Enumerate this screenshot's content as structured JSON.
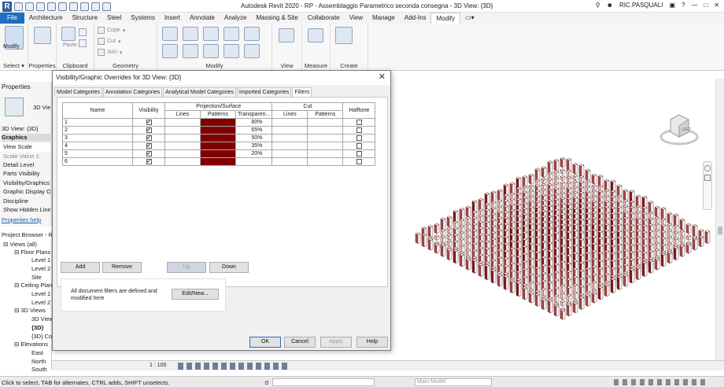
{
  "app": {
    "title": "Autodesk Revit 2020 - RP - Assemblaggio Parametrico seconda consegna - 3D View: {3D}",
    "user": "RIC.PASQUALI"
  },
  "ribbon": {
    "tabs": [
      "File",
      "Architecture",
      "Structure",
      "Steel",
      "Systems",
      "Insert",
      "Annotate",
      "Analyze",
      "Massing & Site",
      "Collaborate",
      "View",
      "Manage",
      "Add-Ins",
      "Modify"
    ],
    "active_tab": "Modify",
    "groups": {
      "select": "Select",
      "properties": "Properties",
      "clipboard": "Clipboard",
      "geometry": "Geometry",
      "modify": "Modify",
      "view": "View",
      "measure": "Measure",
      "create": "Create"
    },
    "modify_label": "Modify",
    "properties_label": "Properties",
    "paste_label": "Paste",
    "cope": "Cope",
    "cut": "Cut",
    "join": "Join"
  },
  "properties_panel": {
    "header": "Properties",
    "type": "3D Vie",
    "instance": "3D View: {3D}",
    "graphics": "Graphics",
    "rows": [
      "View Scale",
      "Scale Value   1:",
      "Detail Level",
      "Parts Visibility",
      "Visibility/Graphics",
      "Graphic Display Op",
      "Discipline",
      "Show Hidden Lines"
    ],
    "help": "Properties help"
  },
  "project_browser": {
    "header": "Project Browser - RP",
    "items": [
      "Views (all)",
      "Floor Plans",
      "Level 1",
      "Level 2",
      "Site",
      "Ceiling Plans",
      "Level 1",
      "Level 2",
      "3D Views",
      "3D View",
      "{3D}",
      "{3D} Co",
      "Elevations",
      "East",
      "North",
      "South"
    ]
  },
  "dialog": {
    "title": "Visibility/Graphic Overrides for 3D View: {3D}",
    "close": "✕",
    "tabs": [
      "Model Categories",
      "Annotation Categories",
      "Analytical Model Categories",
      "Imported Categories",
      "Filters"
    ],
    "active_tab": "Filters",
    "columns": {
      "name": "Name",
      "visibility": "Visibility",
      "projection": "Projection/Surface",
      "cut": "Cut",
      "halftone": "Halftone",
      "lines": "Lines",
      "patterns": "Patterns",
      "transparency": "Transparen..."
    },
    "rows": [
      {
        "name": "1",
        "visible": true,
        "transparency": "80%"
      },
      {
        "name": "2",
        "visible": true,
        "transparency": "65%"
      },
      {
        "name": "3",
        "visible": true,
        "transparency": "50%"
      },
      {
        "name": "4",
        "visible": true,
        "transparency": "35%"
      },
      {
        "name": "5",
        "visible": true,
        "transparency": "20%"
      },
      {
        "name": "6",
        "visible": true,
        "transparency": ""
      }
    ],
    "pattern_color": "#800000",
    "buttons": {
      "add": "Add",
      "remove": "Remove",
      "up": "Up",
      "down": "Down",
      "edit": "Edit/New...",
      "ok": "OK",
      "cancel": "Cancel",
      "apply": "Apply",
      "help": "Help"
    },
    "filter_note": "All document filters are defined and modified here"
  },
  "view_control": {
    "scale": "1 : 100"
  },
  "status": {
    "text": "Click to select, TAB for alternates, CTRL adds, SHIFT unselects.",
    "zero": ":0",
    "model": "Main Model"
  },
  "viewcube": {
    "face": "LEFT"
  }
}
